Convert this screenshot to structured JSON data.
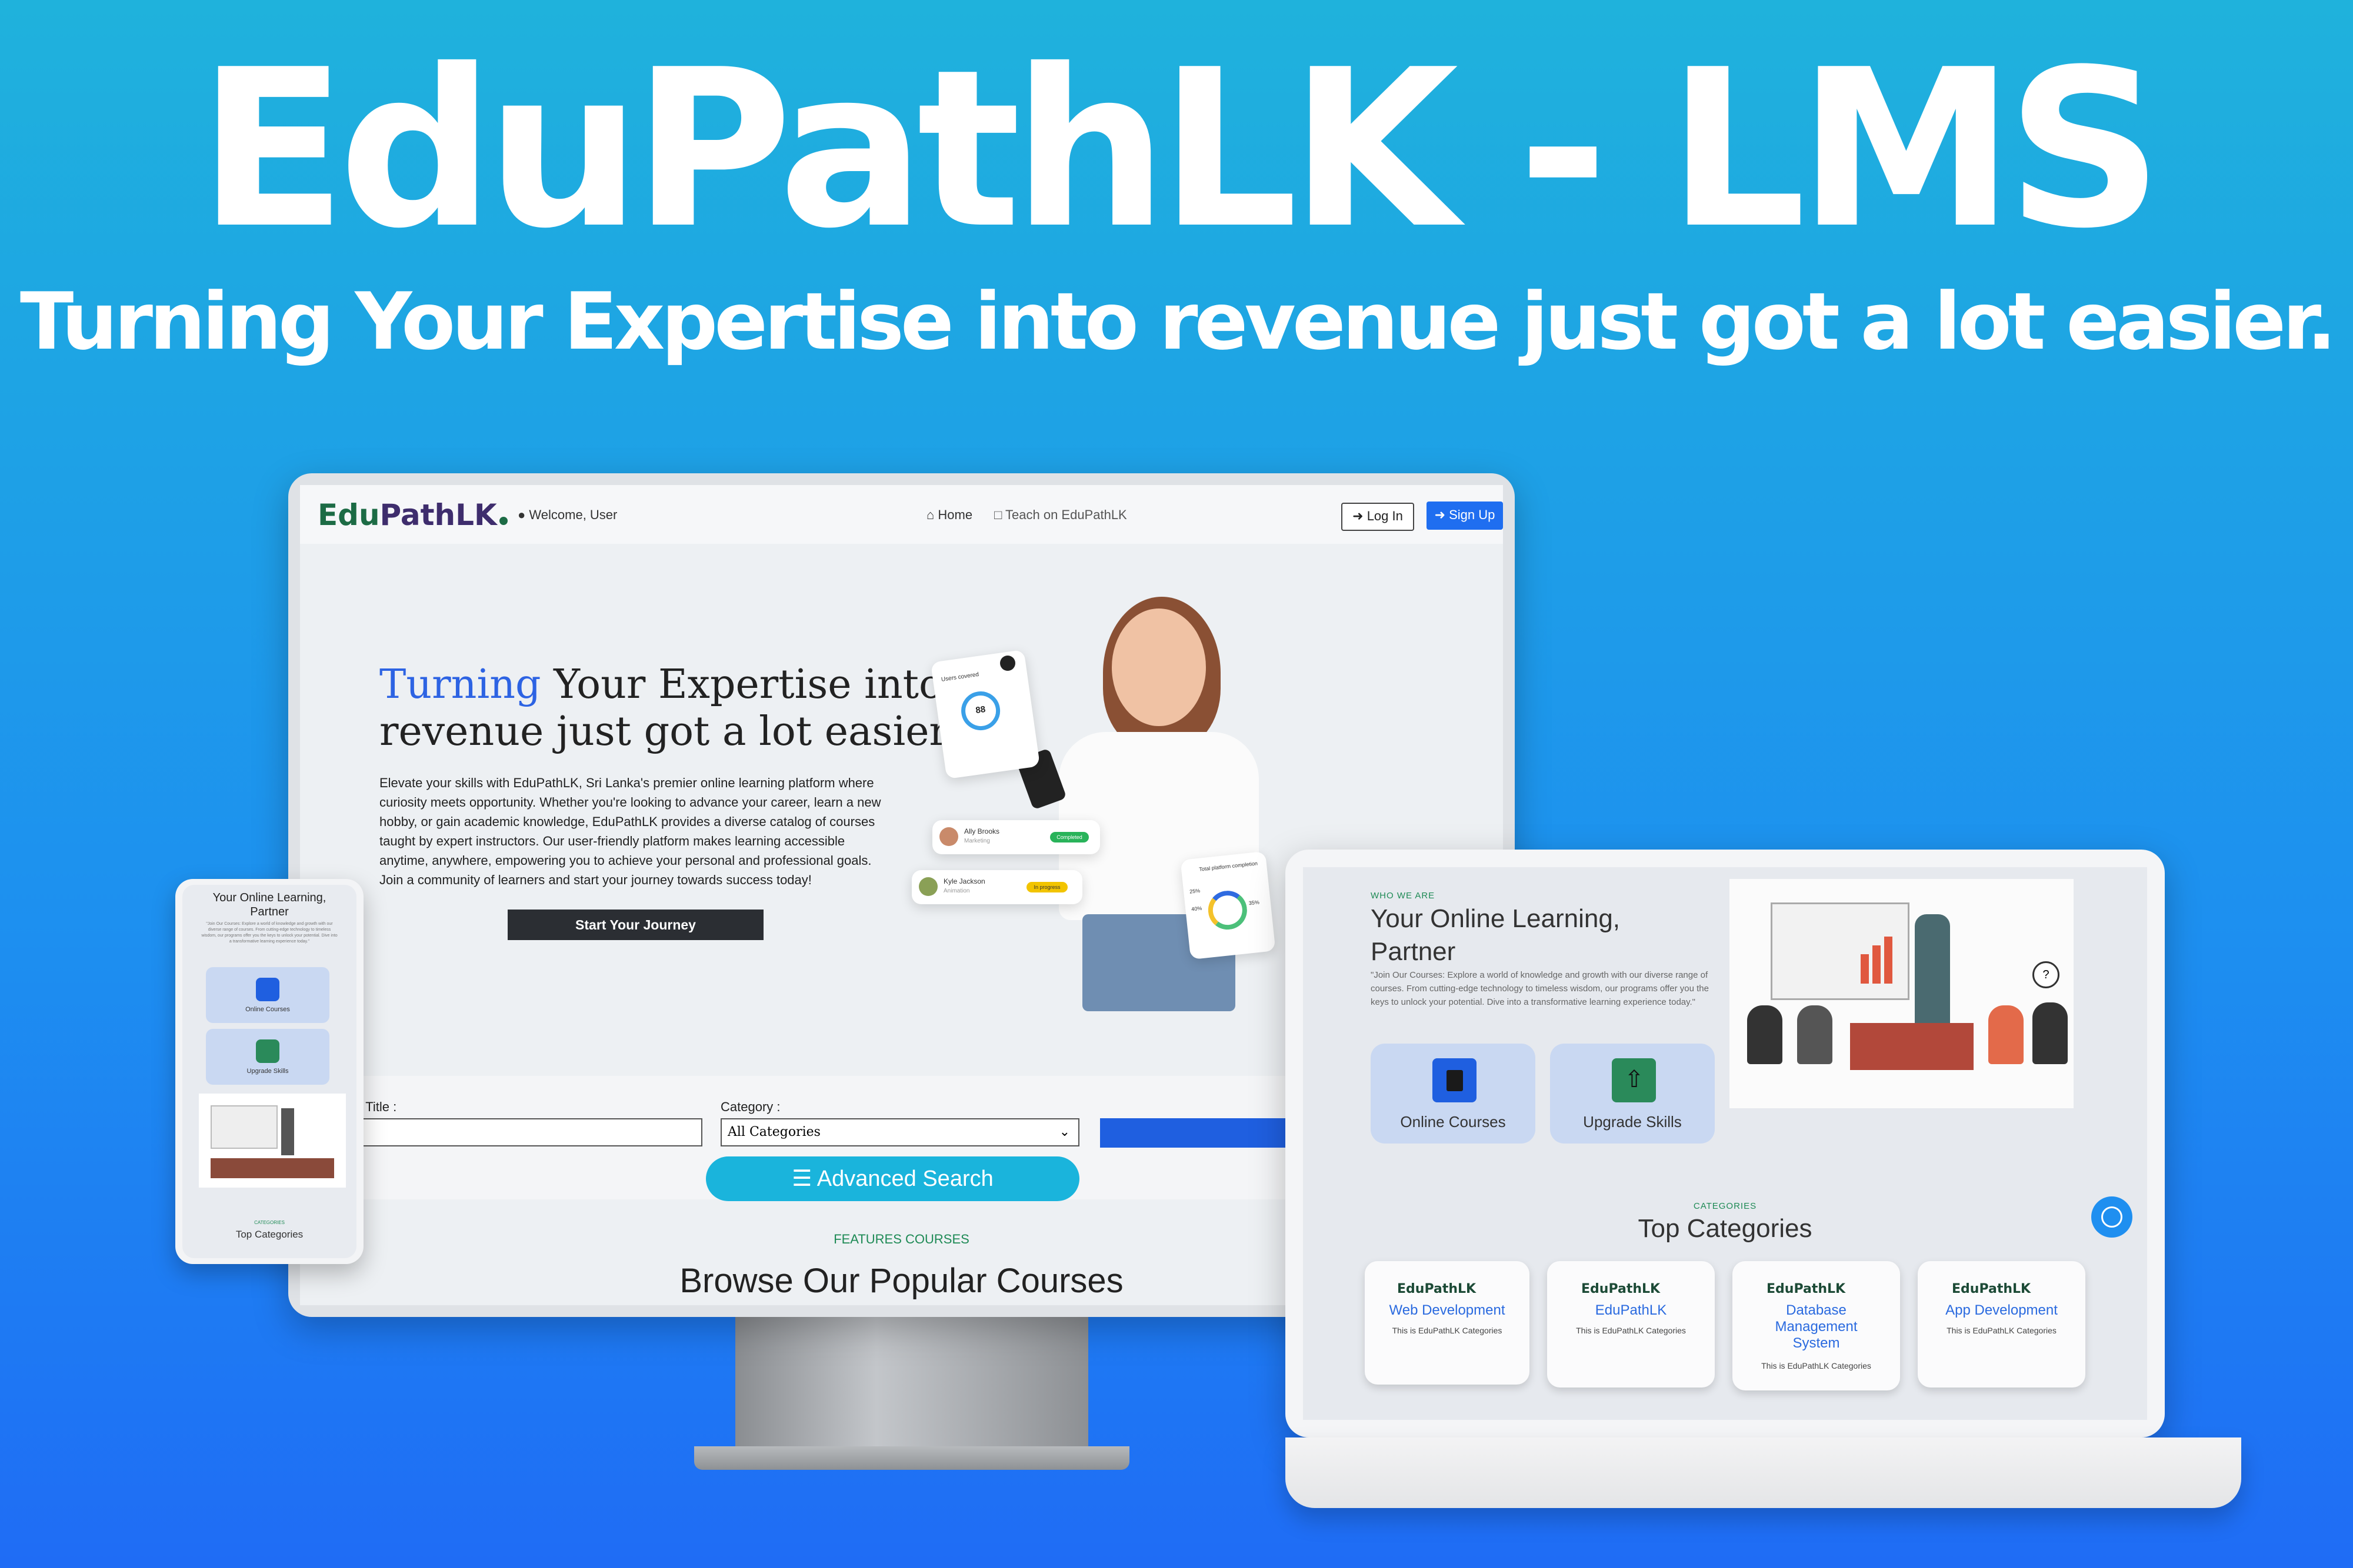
{
  "banner": {
    "title": "EduPathLK - LMS",
    "subtitle": "Turning Your Expertise into revenue just got a lot easier."
  },
  "brand": {
    "logo_text_a": "Edu",
    "logo_text_b": "PathLK",
    "color_green": "#1c6b45",
    "color_purple": "#3e2d6d",
    "accent_blue": "#1f6ef0"
  },
  "desktop": {
    "nav": {
      "welcome": "Welcome, User",
      "home": "Home",
      "teach": "Teach on EduPathLK",
      "login": "Log In",
      "signup": "Sign Up"
    },
    "hero": {
      "title_highlight": "Turning",
      "title_rest_line1": " Your Expertise into",
      "title_line2": "revenue just got a lot easier.",
      "body": "Elevate your skills with EduPathLK, Sri Lanka's premier online learning platform where curiosity meets opportunity. Whether you're looking to advance your career, learn a new hobby, or gain academic knowledge, EduPathLK provides a diverse catalog of courses taught by expert instructors. Our user-friendly platform makes learning accessible anytime, anywhere, empowering you to achieve your personal and professional goals. Join a community of learners and start your journey towards success today!",
      "cta": "Start Your Journey"
    },
    "floating": {
      "users_label": "Users covered",
      "users_value": "88",
      "card1_name": "Ally Brooks",
      "card1_role": "Marketing",
      "card1_badge": "Completed",
      "card2_name": "Kyle Jackson",
      "card2_role": "Animation",
      "card2_badge": "In progress",
      "completion_label": "Total platform completion",
      "pct_a": "25%",
      "pct_b": "40%",
      "pct_c": "35%"
    },
    "search": {
      "course_title_label": "rse Title :",
      "category_label": "Category :",
      "category_value": "All Categories",
      "find_label": "Fi",
      "advanced": "Advanced Search"
    },
    "features_label": "FEATURES COURSES",
    "browse_title": "Browse Our Popular Courses"
  },
  "laptop": {
    "who_label": "WHO WE ARE",
    "heading_line1": "Your Online Learning,",
    "heading_line2": "Partner",
    "paragraph": "\"Join Our Courses: Explore a world of knowledge and growth with our diverse range of courses. From cutting-edge technology to timeless wisdom, our programs offer you the keys to unlock your potential. Dive into a transformative learning experience today.\"",
    "features": [
      {
        "label": "Online Courses",
        "icon": "book-icon",
        "color": "#1f5fe0"
      },
      {
        "label": "Upgrade Skills",
        "icon": "upload-icon",
        "color": "#2a8a5a"
      }
    ],
    "categories_label": "CATEGORIES",
    "categories_title": "Top Categories",
    "categories": [
      {
        "logo": "EduPathLK",
        "title": "Web Development",
        "sub": "This is EduPathLK Categories"
      },
      {
        "logo": "EduPathLK",
        "title": "EduPathLK",
        "sub": "This is EduPathLK Categories"
      },
      {
        "logo": "EduPathLK",
        "title": "Database Management System",
        "sub": "This is EduPathLK Categories"
      },
      {
        "logo": "EduPathLK",
        "title": "App Development",
        "sub": "This is EduPathLK Categories"
      }
    ]
  },
  "phone": {
    "heading_line1": "Your Online Learning,",
    "heading_line2": "Partner",
    "paragraph": "\"Join Our Courses: Explore a world of knowledge and growth with our diverse range of courses. From cutting-edge technology to timeless wisdom, our programs offer you the keys to unlock your potential. Dive into a transformative learning experience today.\"",
    "card1": "Online Courses",
    "card2": "Upgrade Skills",
    "categories_label": "CATEGORIES",
    "categories_title": "Top Categories"
  }
}
